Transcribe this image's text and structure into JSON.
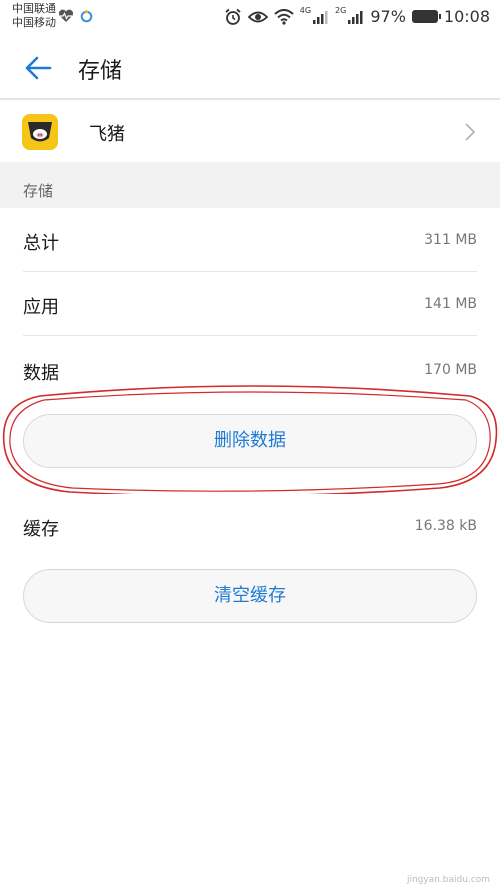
{
  "status_bar": {
    "carrier_1": "中国联通",
    "carrier_2": "中国移动",
    "net_tag_1": "4G",
    "net_tag_2": "2G",
    "battery": "97%",
    "time": "10:08"
  },
  "header": {
    "title": "存储"
  },
  "app": {
    "name": "飞猪"
  },
  "section": {
    "label": "存储"
  },
  "rows": [
    {
      "label": "总计",
      "value": "311 MB"
    },
    {
      "label": "应用",
      "value": "141 MB"
    },
    {
      "label": "数据",
      "value": "170 MB"
    }
  ],
  "clear_data_button": "删除数据",
  "cache": {
    "label": "缓存",
    "value": "16.38 kB"
  },
  "clear_cache_button": "清空缓存",
  "watermark": "jingyan.baidu.com",
  "colors": {
    "accent": "#1f7ad3",
    "annotation": "#d32a2a",
    "app_icon": "#f5c518"
  }
}
